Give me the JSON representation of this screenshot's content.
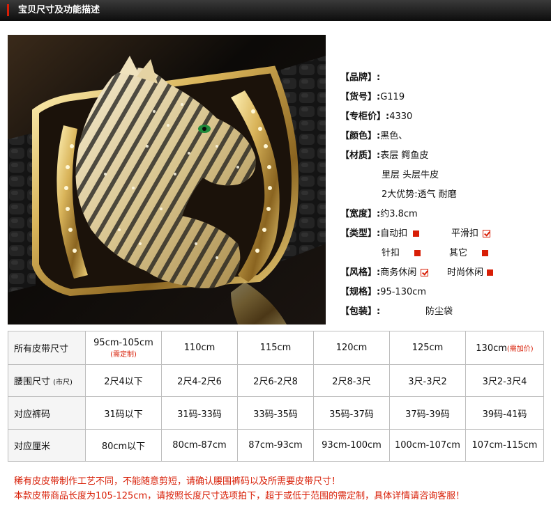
{
  "header": {
    "title": "宝贝尺寸及功能描述"
  },
  "photo": {
    "alt": "belt-buckle-photo"
  },
  "specs": {
    "brand_label": "【品牌】:",
    "brand_value": "",
    "model_label": "【货号】:",
    "model_value": "G119",
    "price_label": "【专柜价】:",
    "price_value": "4330",
    "color_label": "【颜色】:",
    "color_value": "黑色、",
    "material_label": "【材质】:",
    "material_outer": "表层  鳄鱼皮",
    "material_inner": "里层  头层牛皮",
    "material_adv": "2大优势:透气  耐磨",
    "width_label": "【宽度】:",
    "width_value": "约3.8cm",
    "type_label": "【类型】:",
    "type_auto": "自动扣",
    "type_smooth": "平滑扣",
    "type_pin": "针扣",
    "type_other": "其它",
    "style_label": "【风格】:",
    "style_business": "商务休闲",
    "style_fashion": "时尚休闲",
    "size_label": "【规格】:",
    "size_value": "95-130cm",
    "package_label": "【包装】:",
    "package_value": "防尘袋"
  },
  "size_table": {
    "rows": [
      {
        "label": "所有皮带尺寸",
        "cells": [
          "95cm-105cm",
          "110cm",
          "115cm",
          "120cm",
          "125cm",
          "130cm"
        ],
        "note_first": "(需定制)",
        "note_last": "(需加价)"
      },
      {
        "label": "腰围尺寸",
        "label_small": "(市尺)",
        "cells": [
          "2尺4以下",
          "2尺4-2尺6",
          "2尺6-2尺8",
          "2尺8-3尺",
          "3尺-3尺2",
          "3尺2-3尺4"
        ]
      },
      {
        "label": "对应裤码",
        "cells": [
          "31码以下",
          "31码-33码",
          "33码-35码",
          "35码-37码",
          "37码-39码",
          "39码-41码"
        ]
      },
      {
        "label": "对应厘米",
        "cells": [
          "80cm以下",
          "80cm-87cm",
          "87cm-93cm",
          "93cm-100cm",
          "100cm-107cm",
          "107cm-115cm"
        ]
      }
    ]
  },
  "notes": {
    "line1": "稀有皮皮带制作工艺不同，不能随意剪短，请确认腰围裤码以及所需要皮带尺寸！",
    "line2": "本款皮带商品长度为105-125cm，请按照长度尺寸选项拍下，超于或低于范围的需定制，具体详情请咨询客服！"
  },
  "colors": {
    "accent": "#d81e06",
    "header_bg": "#1a1a1a",
    "gold": "#d9b45a"
  }
}
